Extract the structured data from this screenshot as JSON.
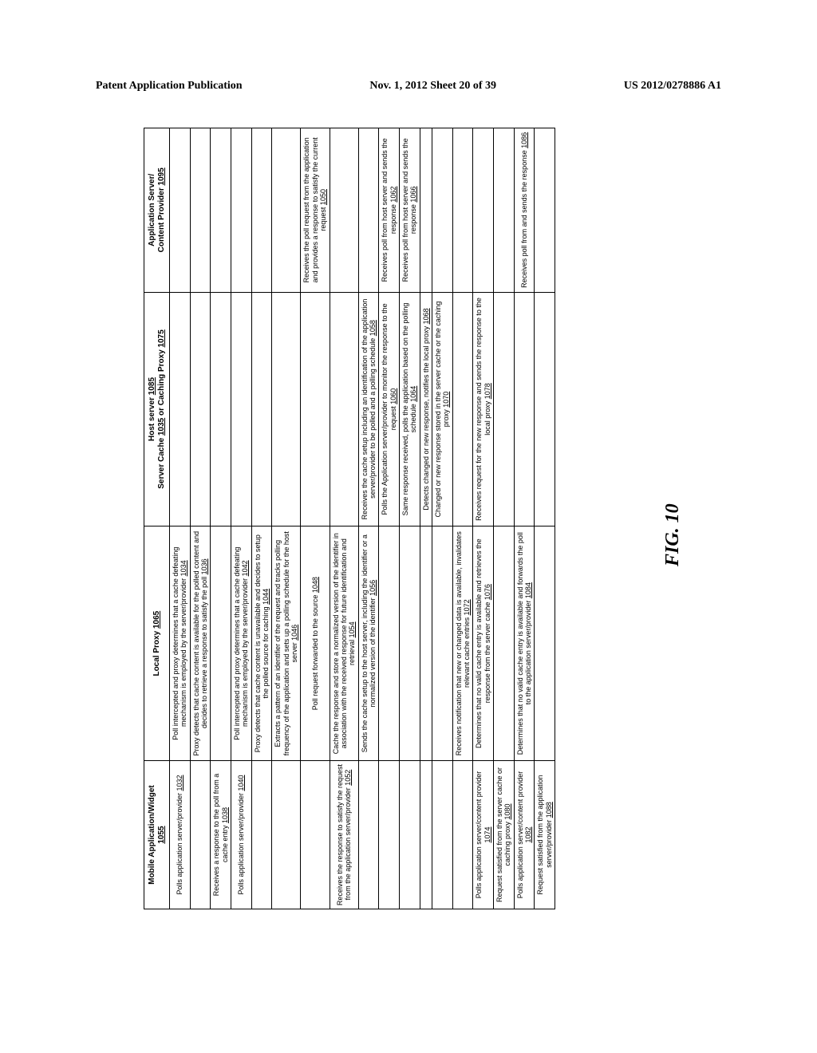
{
  "header": {
    "left": "Patent Application Publication",
    "center": "Nov. 1, 2012  Sheet 20 of 39",
    "right": "US 2012/0278886 A1"
  },
  "figure_label": "FIG. 10",
  "columns": {
    "c0": {
      "line1": "Mobile Application/Widget",
      "ref": "1055"
    },
    "c1": {
      "line1": "Local Proxy",
      "ref": "1065"
    },
    "c2": {
      "line1": "Host server",
      "ref_a": "1085",
      "line2": "Server Cache",
      "ref_b": "1035",
      "line3": " or Caching Proxy",
      "ref_c": "1075"
    },
    "c3": {
      "line1": "Application Server/",
      "line2": "Content Provider",
      "ref": "1095"
    }
  },
  "rows": [
    {
      "c0": {
        "text": "Polls application server/provider",
        "ref": "1032"
      },
      "c1": {
        "text": "Poll intercepted and proxy determines that a cache defeating mechanism is employed by the server/provider",
        "ref": "1034"
      },
      "c2": null,
      "c3": null
    },
    {
      "c0": null,
      "c1": {
        "text": "Proxy detects that cache content is available for the polled content and decides to retrieve a response to satisfy the poll",
        "ref": "1036"
      },
      "c2": null,
      "c3": null
    },
    {
      "c0": {
        "text": "Receives a response to the poll from a cache entry",
        "ref": "1038"
      },
      "c1": null,
      "c2": null,
      "c3": null
    },
    {
      "c0": {
        "text": "Polls application server/provider",
        "ref": "1040"
      },
      "c1": {
        "text": "Poll intercepted and proxy determines that a cache defeating mechanism is employed by the server/provider",
        "ref": "1042"
      },
      "c2": null,
      "c3": null
    },
    {
      "c0": null,
      "c1": {
        "text": "Proxy detects that cache content is unavailable and decides to setup the polled source for caching",
        "ref": "1044"
      },
      "c2": null,
      "c3": null
    },
    {
      "c0": null,
      "c1": {
        "text": "Extracts a pattern of an identifier of the request and tracks polling frequency of the application and sets up a polling schedule for the host server",
        "ref": "1046"
      },
      "c2": null,
      "c3": null
    },
    {
      "c0": null,
      "c1": {
        "text": "Poll request forwarded to the source",
        "ref": "1048"
      },
      "c2": null,
      "c3": {
        "text": "Receives the poll request from the application and provides a response to satisfy the current request",
        "ref": "1050"
      }
    },
    {
      "c0": {
        "text": "Receives the response to satisfy the request from the application server/provider",
        "ref": "1052"
      },
      "c1": {
        "text": "Cache the response and store a normalized version of the identifier in association with the received response for future identification and retrieval",
        "ref": "1054"
      },
      "c2": null,
      "c3": null
    },
    {
      "c0": null,
      "c1": {
        "text": "Sends the cache setup to the host server, including the identifier or a normalized version of the identifier",
        "ref": "1056"
      },
      "c2": {
        "text": "Receives the cache setup including an identification of the application server/provider to be polled and a polling schedule",
        "ref": "1058"
      },
      "c3": null
    },
    {
      "c0": null,
      "c1": null,
      "c2": {
        "text": "Polls the Application server/provider to monitor the response to the request",
        "ref": "1060"
      },
      "c3": {
        "text": "Receives poll from host server and sends the response",
        "ref": "1062"
      }
    },
    {
      "c0": null,
      "c1": null,
      "c2": {
        "text": "Same response received, polls the application based on the polling schedule",
        "ref": "1064"
      },
      "c3": {
        "text": "Receives poll from host server and sends the response",
        "ref": "1066"
      }
    },
    {
      "c0": null,
      "c1": null,
      "c2": {
        "text": "Detects changed or new response, notifies the local proxy",
        "ref": "1068"
      },
      "c3": null
    },
    {
      "c0": null,
      "c1": null,
      "c2": {
        "text": "Changed or new response stored in the server cache or the caching proxy",
        "ref": "1070"
      },
      "c3": null
    },
    {
      "c0": null,
      "c1": {
        "text": "Receives notification that new or changed data is available, invalidates relevant cache entries",
        "ref": "1072"
      },
      "c2": null,
      "c3": null
    },
    {
      "c0": {
        "text": "Polls application server/content provider",
        "ref": "1074"
      },
      "c1": {
        "text": "Determines that no valid cache entry is available and retrieves the response from the server cache",
        "ref": "1076"
      },
      "c2": {
        "text": "Receives request for the new response and sends the response to the local proxy",
        "ref": "1078"
      },
      "c3": null
    },
    {
      "c0": {
        "text": "Request satisfied from the server cache or caching proxy",
        "ref": "1080"
      },
      "c1": null,
      "c2": null,
      "c3": null
    },
    {
      "c0": {
        "text": "Polls application server/content provider",
        "ref": "1082"
      },
      "c1": {
        "text": "Determines that no valid cache entry is available and forwards the poll to the application server/provider",
        "ref": "1084"
      },
      "c2": null,
      "c3": {
        "text": "Receives poll from and sends the response",
        "ref": "1086"
      }
    },
    {
      "c0": {
        "text": "Request satisfied from the application server/provider",
        "ref": "1088"
      },
      "c1": null,
      "c2": null,
      "c3": null
    }
  ]
}
